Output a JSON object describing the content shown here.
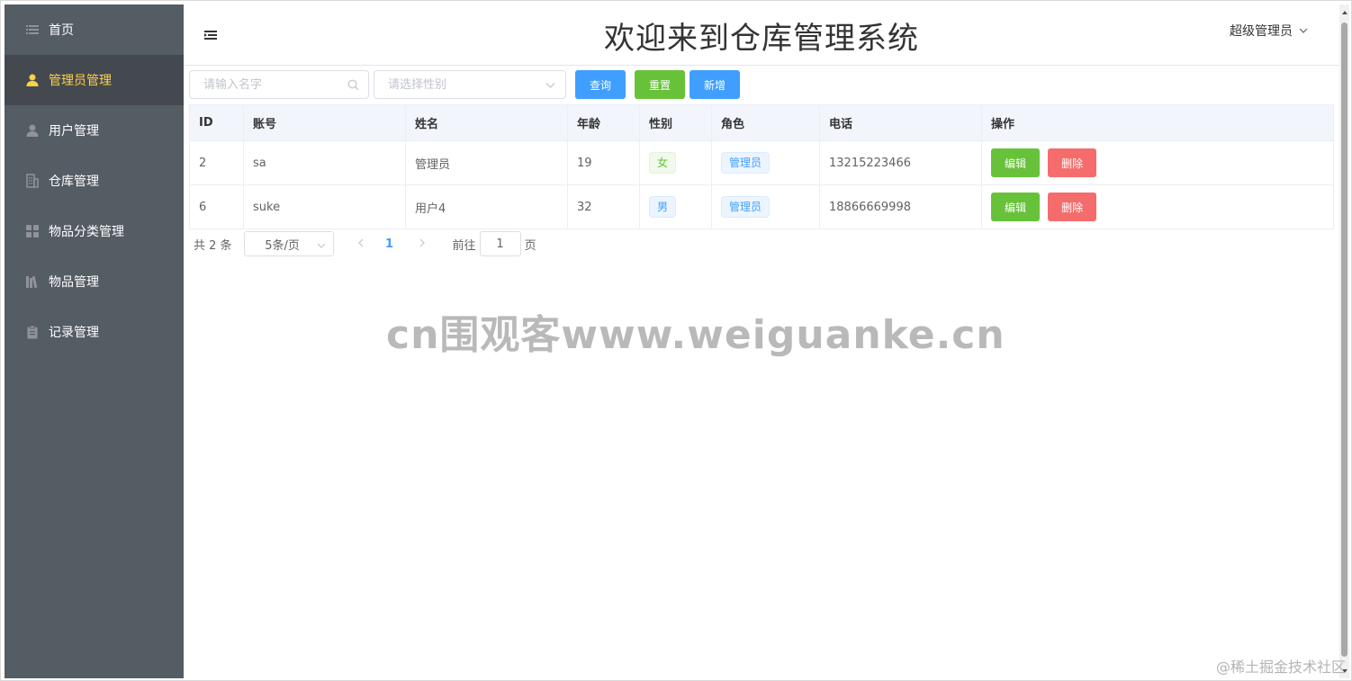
{
  "sidebar": {
    "items": [
      {
        "label": "首页",
        "icon": "menu-list-icon",
        "active": false
      },
      {
        "label": "管理员管理",
        "icon": "user-filled-icon",
        "active": true
      },
      {
        "label": "用户管理",
        "icon": "user-icon",
        "active": false
      },
      {
        "label": "仓库管理",
        "icon": "building-icon",
        "active": false
      },
      {
        "label": "物品分类管理",
        "icon": "grid-icon",
        "active": false
      },
      {
        "label": "物品管理",
        "icon": "books-icon",
        "active": false
      },
      {
        "label": "记录管理",
        "icon": "clipboard-icon",
        "active": false
      }
    ],
    "background": "#545c64",
    "active_text_color": "#ffd04b"
  },
  "header": {
    "title": "欢迎来到仓库管理系统",
    "user_label": "超级管理员"
  },
  "toolbar": {
    "name_placeholder": "请输入名字",
    "gender_placeholder": "请选择性别",
    "query_label": "查询",
    "reset_label": "重置",
    "add_label": "新增"
  },
  "table": {
    "columns": [
      "ID",
      "账号",
      "姓名",
      "年龄",
      "性别",
      "角色",
      "电话",
      "操作"
    ],
    "rows": [
      {
        "id": "2",
        "account": "sa",
        "name": "管理员",
        "age": "19",
        "gender": "女",
        "role": "管理员",
        "phone": "13215223466",
        "edit": "编辑",
        "delete": "删除"
      },
      {
        "id": "6",
        "account": "suke",
        "name": "用户4",
        "age": "32",
        "gender": "男",
        "role": "管理员",
        "phone": "18866669998",
        "edit": "编辑",
        "delete": "删除"
      }
    ]
  },
  "pagination": {
    "total_text": "共 2 条",
    "page_size": "5条/页",
    "current_page": "1",
    "goto_label": "前往",
    "goto_value": "1",
    "page_suffix": "页"
  },
  "watermark": {
    "center": "cn围观客www.weiguanke.cn",
    "corner": "@稀土掘金技术社区"
  },
  "colors": {
    "primary": "#409eff",
    "success": "#67c23a",
    "danger": "#f56c6c",
    "header_bg": "#f2f5fc"
  }
}
